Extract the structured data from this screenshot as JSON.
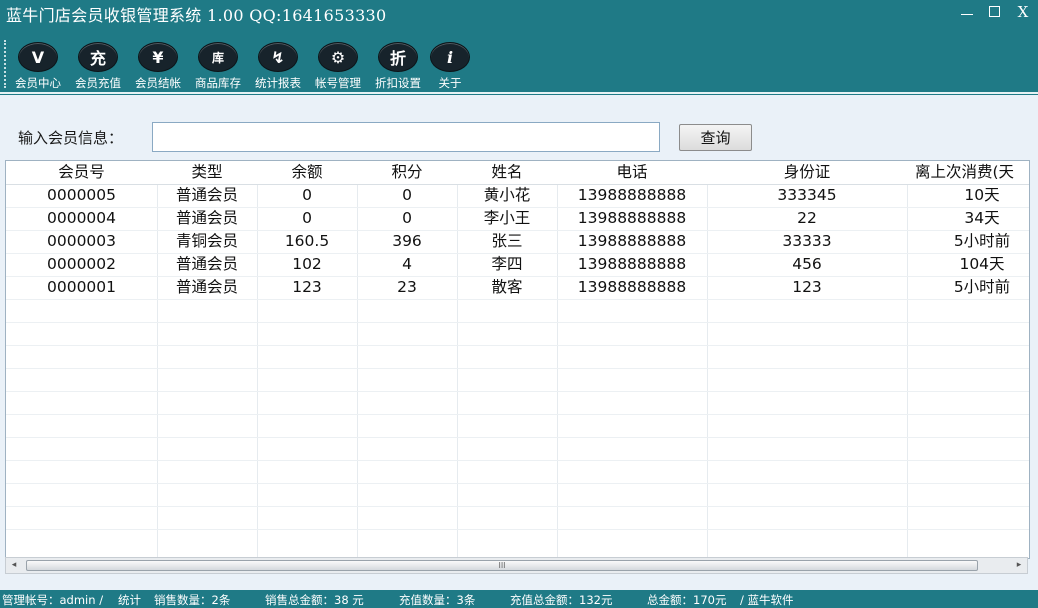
{
  "window": {
    "title": "蓝牛门店会员收银管理系统 1.00   QQ:1641653330",
    "minimize": "—",
    "maximize": "☐",
    "close": "X"
  },
  "toolbar": {
    "items": [
      {
        "label": "会员中心",
        "icon": "vip-icon",
        "glyph": "V"
      },
      {
        "label": "会员充值",
        "icon": "recharge-icon",
        "glyph": "充"
      },
      {
        "label": "会员结帐",
        "icon": "yuan-icon",
        "glyph": "¥"
      },
      {
        "label": "商品库存",
        "icon": "warehouse-icon",
        "glyph": "库"
      },
      {
        "label": "统计报表",
        "icon": "chart-icon",
        "glyph": "↯"
      },
      {
        "label": "帐号管理",
        "icon": "user-gear-icon",
        "glyph": "⚙"
      },
      {
        "label": "折扣设置",
        "icon": "discount-icon",
        "glyph": "折"
      },
      {
        "label": "关于",
        "icon": "info-icon",
        "glyph": "i"
      }
    ]
  },
  "search": {
    "label": "输入会员信息：",
    "value": "",
    "button": "查询"
  },
  "table": {
    "columns": [
      "会员号",
      "类型",
      "余额",
      "积分",
      "姓名",
      "电话",
      "身份证",
      "离上次消费(天"
    ],
    "rows": [
      [
        "0000005",
        "普通会员",
        "0",
        "0",
        "黄小花",
        "13988888888",
        "333345",
        "10天"
      ],
      [
        "0000004",
        "普通会员",
        "0",
        "0",
        "李小王",
        "13988888888",
        "22",
        "34天"
      ],
      [
        "0000003",
        "青铜会员",
        "160.5",
        "396",
        "张三",
        "13988888888",
        "33333",
        "5小时前"
      ],
      [
        "0000002",
        "普通会员",
        "102",
        "4",
        "李四",
        "13988888888",
        "456",
        "104天"
      ],
      [
        "0000001",
        "普通会员",
        "123",
        "23",
        "散客",
        "13988888888",
        "123",
        "5小时前"
      ]
    ]
  },
  "scrollbar": {
    "left_arrow": "◂",
    "right_arrow": "▸",
    "grip": "III"
  },
  "statusbar": {
    "account": "管理帐号：admin /",
    "stats": "统计",
    "sales_count": "销售数量：2条",
    "sales_total": "销售总金额：38 元",
    "recharge_count": "充值数量：3条",
    "recharge_total": "充值总金额：132元",
    "grand_total": "总金额：170元",
    "vendor": "/ 蓝牛软件"
  },
  "colors": {
    "frame": "#1f7a86",
    "client": "#eaf1f8",
    "icon_bg": "#17232b"
  }
}
